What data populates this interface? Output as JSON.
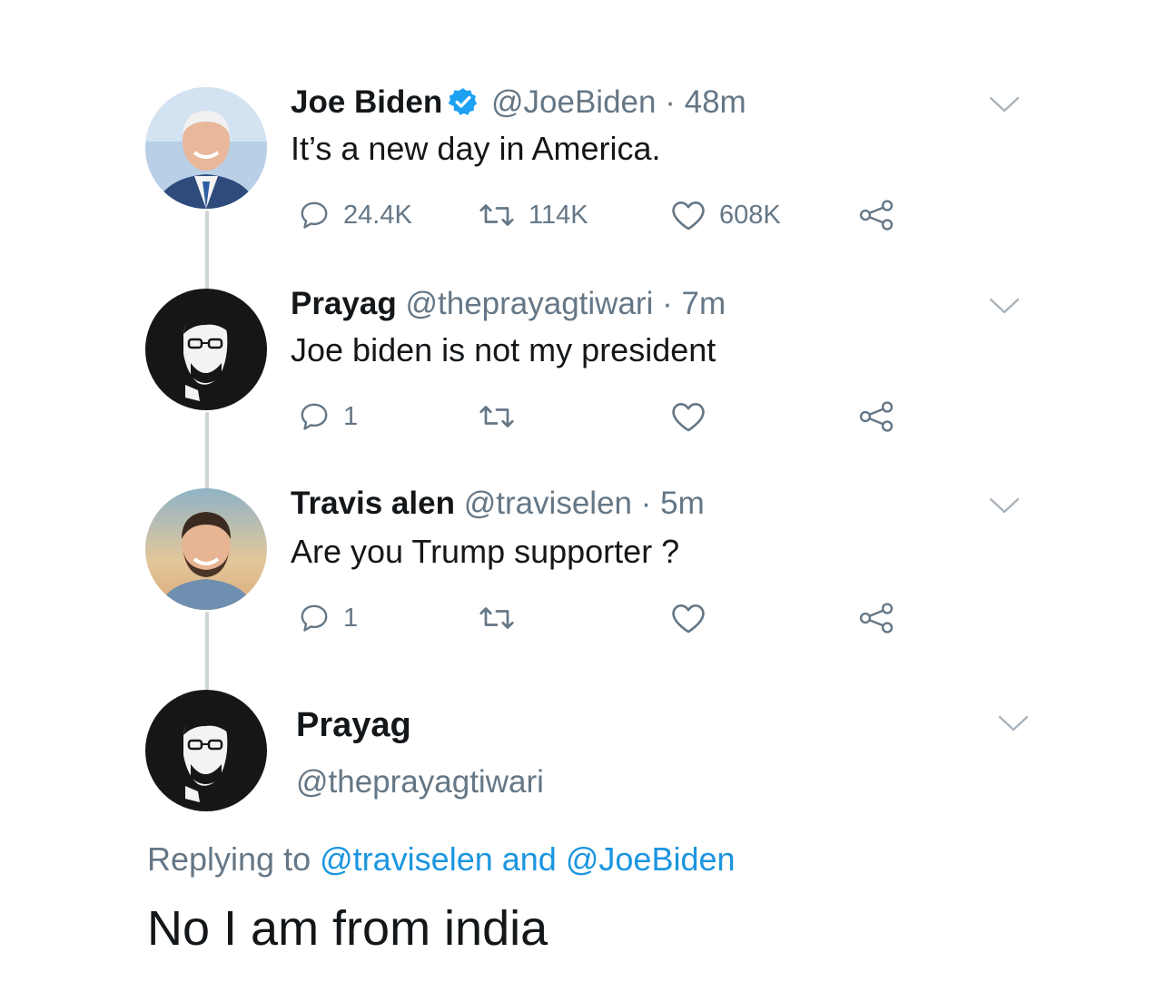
{
  "colors": {
    "text": "#14171a",
    "secondary": "#657786",
    "link": "#1b95e0",
    "verified": "#1da1f2",
    "thread_line": "#cfd4d8"
  },
  "tweets": [
    {
      "name": "Joe Biden",
      "verified": true,
      "handle": "@JoeBiden",
      "separator": "·",
      "time": "48m",
      "text": "It’s a new day in America.",
      "replies": "24.4K",
      "retweets": "114K",
      "likes": "608K",
      "avatar_icon": "joe-biden-photo"
    },
    {
      "name": "Prayag",
      "verified": false,
      "handle": "@theprayagtiwari",
      "separator": "·",
      "time": "7m",
      "text": "Joe biden is not my president",
      "replies": "1",
      "retweets": "",
      "likes": "",
      "avatar_icon": "prayag-sketch-avatar"
    },
    {
      "name": "Travis alen",
      "verified": false,
      "handle": "@traviselen",
      "separator": "·",
      "time": "5m",
      "text": "Are you Trump supporter ?",
      "replies": "1",
      "retweets": "",
      "likes": "",
      "avatar_icon": "travis-photo"
    }
  ],
  "detail": {
    "name": "Prayag",
    "handle": "@theprayagtiwari",
    "replying_prefix": "Replying to",
    "replying_user1": "@traviselen",
    "replying_and": "and",
    "replying_user2": "@JoeBiden",
    "text": "No I am from india",
    "avatar_icon": "prayag-sketch-avatar"
  }
}
